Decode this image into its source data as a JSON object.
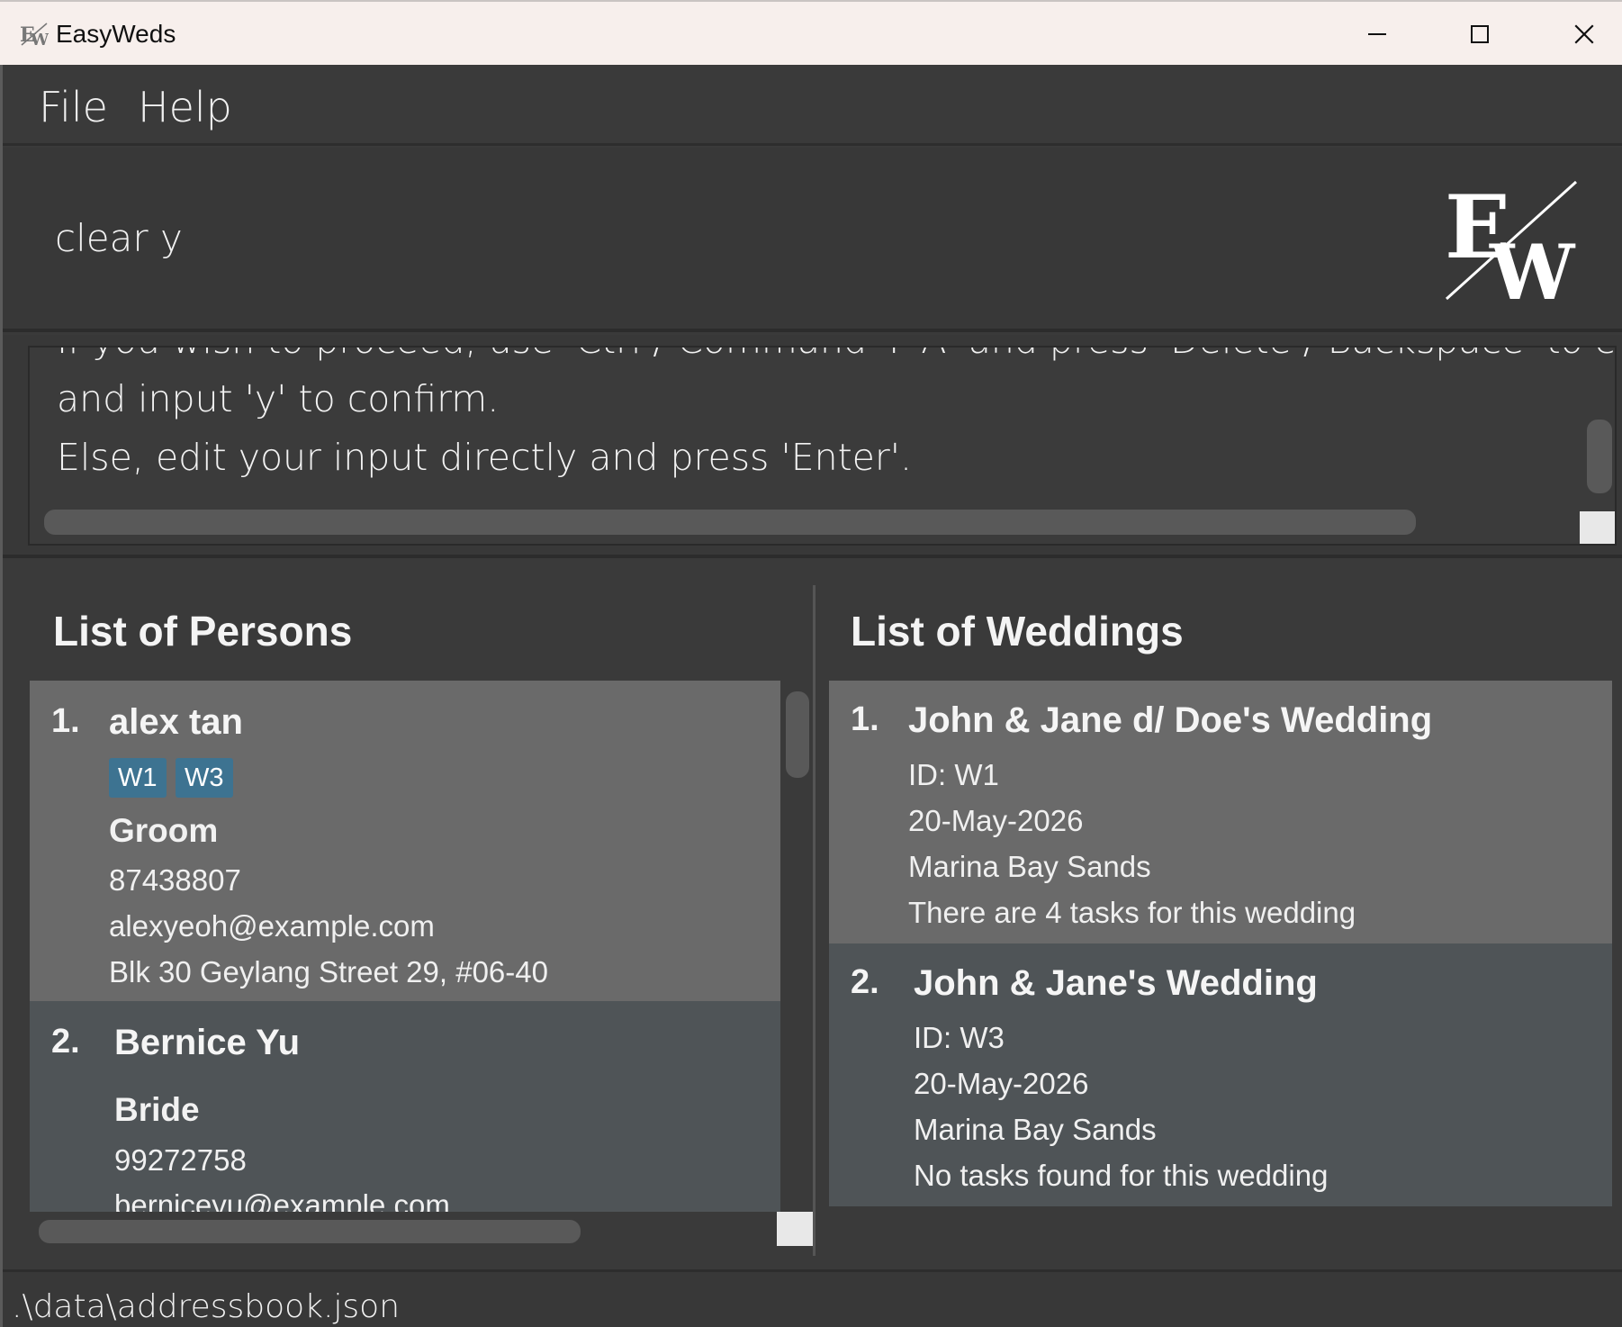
{
  "window": {
    "title": "EasyWeds",
    "minimize_icon": "minimize-icon",
    "maximize_icon": "maximize-icon",
    "close_icon": "close-icon"
  },
  "menu": {
    "items": [
      {
        "label": "File"
      },
      {
        "label": "Help"
      }
    ]
  },
  "command": {
    "value": "clear y",
    "logo": "EW-logo"
  },
  "result": {
    "lines": [
      "If you wish to proceed, use 'Ctrl / Command + A' and press 'Delete / Backspace' to clear the i",
      "and input 'y' to confirm.",
      "Else, edit your input directly and press 'Enter'."
    ]
  },
  "persons": {
    "title": "List of Persons",
    "items": [
      {
        "index": "1.",
        "name": "alex tan",
        "tags": [
          "W1",
          "W3"
        ],
        "role": "Groom",
        "phone": "87438807",
        "email": "alexyeoh@example.com",
        "address": "Blk 30 Geylang Street 29, #06-40"
      },
      {
        "index": "2.",
        "name": "Bernice Yu",
        "tags": [],
        "role": "Bride",
        "phone": "99272758",
        "email": "berniceyu@example.com"
      }
    ]
  },
  "weddings": {
    "title": "List of Weddings",
    "items": [
      {
        "index": "1.",
        "name": "John & Jane d/ Doe's Wedding",
        "id": "ID: W1",
        "date": "20-May-2026",
        "venue": "Marina Bay Sands",
        "tasks": "There are 4 tasks for this wedding"
      },
      {
        "index": "2.",
        "name": "John & Jane's Wedding",
        "id": "ID: W3",
        "date": "20-May-2026",
        "venue": "Marina Bay Sands",
        "tasks": "No tasks found for this wedding"
      }
    ]
  },
  "status": {
    "path": ".\\data\\addressbook.json"
  },
  "colors": {
    "background": "#3a3a3a",
    "card_selected": "#6a6a6a",
    "card_normal": "#4f5457",
    "tag": "#3d7391",
    "titlebar": "#f7efec"
  }
}
